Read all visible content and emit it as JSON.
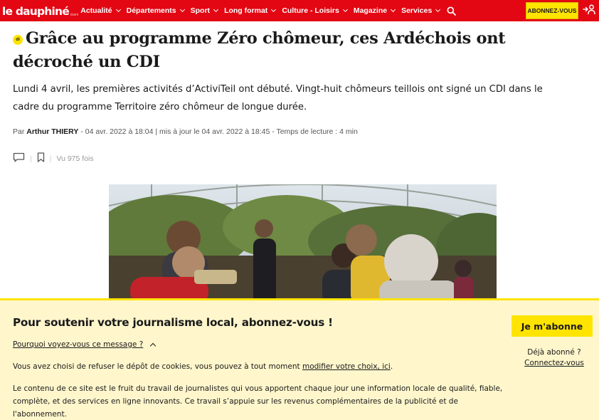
{
  "header": {
    "logo": "le dauphiné",
    "logo_sub": "libéré",
    "nav": [
      {
        "label": "Actualité"
      },
      {
        "label": "Départements"
      },
      {
        "label": "Sport"
      },
      {
        "label": "Long format"
      },
      {
        "label": "Culture - Loisirs"
      },
      {
        "label": "Magazine"
      },
      {
        "label": "Services"
      }
    ],
    "subscribe_label": "ABONNEZ-VOUS",
    "icons": {
      "search": "search-icon",
      "login": "login-icon",
      "chevron": "chevron-down-icon"
    }
  },
  "article": {
    "badge": "di",
    "title": "Grâce au programme Zéro chômeur, ces Ardéchois ont décroché un CDI",
    "chapo": "Lundi 4 avril, les premières activités d’ActiviTeil ont débuté. Vingt-huit chômeurs teillois ont signé un CDI dans le cadre du programme Territoire zéro chômeur de longue durée.",
    "byline": {
      "prefix": "Par",
      "author": "Arthur THIERY",
      "meta": "- 04 avr. 2022 à 18:04 | mis à jour le 04 avr. 2022 à 18:45 - Temps de lecture : 4 min"
    },
    "views": "Vu 975 fois",
    "icons": {
      "comment": "comment-icon",
      "bookmark": "bookmark-icon"
    }
  },
  "paywall": {
    "title": "Pour soutenir votre journalisme local, abonnez-vous !",
    "why": "Pourquoi voyez-vous ce message ?",
    "cookies_text": "Vous avez choisi de refuser le dépôt de cookies, vous pouvez à tout moment ",
    "cookies_link": "modifier votre choix, ici",
    "cookies_end": ".",
    "content_text": "Le contenu de ce site est le fruit du travail de journalistes qui vous apportent chaque jour une information locale de qualité, fiable, complète, et des services en ligne innovants. Ce travail s’appuie sur les revenus complémentaires de la publicité et de l'abonnement.",
    "subscribe_button": "Je m'abonne",
    "already": "Déjà abonné ?",
    "connect": "Connectez-vous"
  },
  "colors": {
    "brand_red": "#e30613",
    "accent_yellow": "#ffe400",
    "paywall_bg": "#fff6cc"
  }
}
